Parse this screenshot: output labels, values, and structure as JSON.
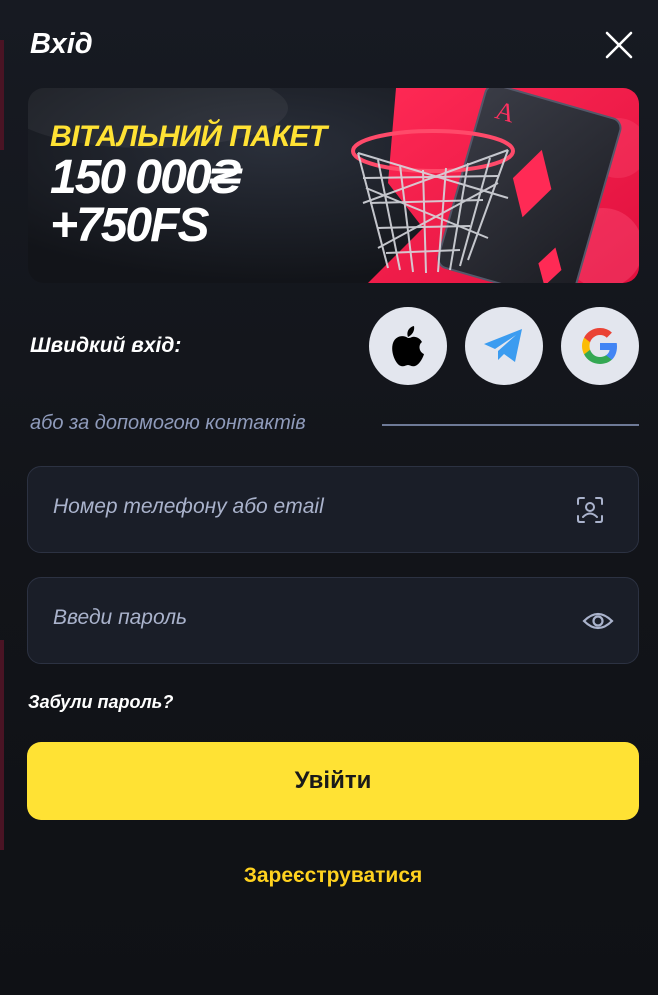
{
  "header": {
    "title": "Вхід",
    "close_icon": "close-icon"
  },
  "banner": {
    "line1": "ВІТАЛЬНИЙ ПАКЕТ",
    "line2": "150 000₴",
    "line3": "+750FS",
    "accent": "#ffe234",
    "art": "basketball-hoop-and-playing-card"
  },
  "quick_login": {
    "label": "Швидкий вхід:",
    "providers": [
      {
        "name": "apple",
        "icon": "apple-icon"
      },
      {
        "name": "telegram",
        "icon": "telegram-icon"
      },
      {
        "name": "google",
        "icon": "google-icon"
      }
    ]
  },
  "divider": {
    "text": "або за допомогою контактів"
  },
  "form": {
    "login_placeholder": "Номер телефону або email",
    "login_icon": "contact-scan-icon",
    "password_placeholder": "Введи пароль",
    "password_icon": "eye-icon",
    "forgot_label": "Забули пароль?",
    "submit_label": "Увійти",
    "register_label": "Зареєструватися"
  },
  "colors": {
    "background": "#121419",
    "primary_button": "#ffe234",
    "link": "#ffd21f",
    "field_bg": "#1a1e28",
    "muted_text": "#8f9bbb"
  }
}
